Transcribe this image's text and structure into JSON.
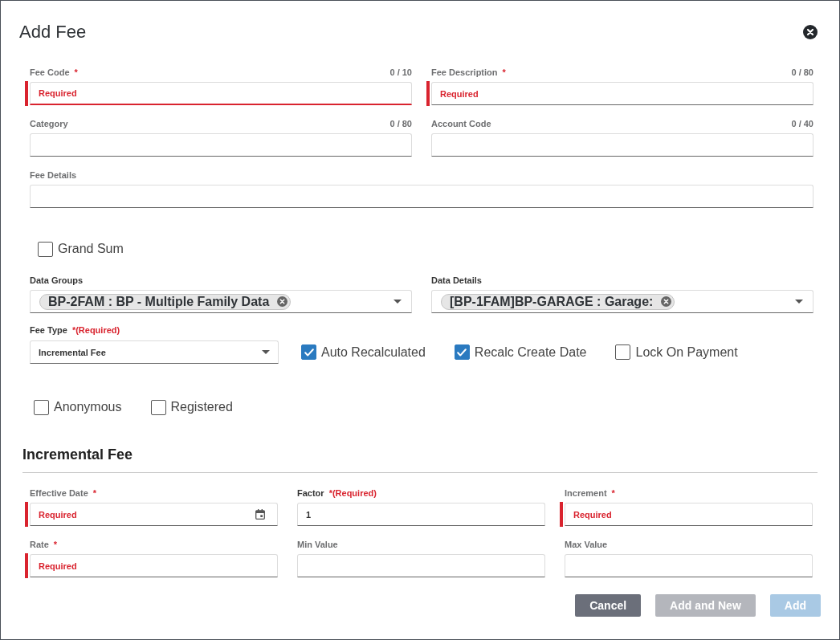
{
  "dialog": {
    "title": "Add Fee"
  },
  "fee_rows": [
    [
      {
        "kind": "text",
        "label": "Fee Code",
        "required_mark": "*",
        "counter": "0 / 10",
        "placeholder": "Required",
        "invalid": true,
        "focused": true
      },
      {
        "kind": "text",
        "label": "Fee Description",
        "required_mark": "*",
        "counter": "0 / 80",
        "placeholder": "Required",
        "invalid": true,
        "focused": false
      }
    ],
    [
      {
        "kind": "text",
        "label": "Category",
        "counter": "0 / 80",
        "invalid": false,
        "focused": false
      },
      {
        "kind": "text",
        "label": "Account Code",
        "counter": "0 / 40",
        "invalid": false,
        "focused": false
      }
    ],
    [
      {
        "kind": "text",
        "label": "Fee Details",
        "invalid": false,
        "focused": false
      }
    ]
  ],
  "grand_sum": {
    "label": "Grand Sum",
    "checked": false
  },
  "data_selects": [
    {
      "label": "Data Groups",
      "chips": [
        "BP-2FAM : BP - Multiple Family Data"
      ]
    },
    {
      "label": "Data Details",
      "chips": [
        "[BP-1FAM]BP-GARAGE : Garage:"
      ]
    }
  ],
  "fee_type": {
    "label": "Fee Type",
    "required_mark": "*(Required)",
    "value": "Incremental Fee"
  },
  "recalc_options": [
    {
      "label": "Auto Recalculated",
      "checked": true
    },
    {
      "label": "Recalc Create Date",
      "checked": true
    },
    {
      "label": "Lock On Payment",
      "checked": false
    }
  ],
  "visibility_options": [
    {
      "label": "Anonymous",
      "checked": false
    },
    {
      "label": "Registered",
      "checked": false
    }
  ],
  "incremental_fee": {
    "title": "Incremental Fee",
    "rows": [
      [
        {
          "kind": "date",
          "label": "Effective Date",
          "required_mark": "*",
          "placeholder": "Required",
          "invalid": true,
          "focused": false
        },
        {
          "kind": "text",
          "label": "Factor",
          "required_mark": "*(Required)",
          "value": "1",
          "invalid": false,
          "focused": false
        },
        {
          "kind": "text",
          "label": "Increment",
          "required_mark": "*",
          "placeholder": "Required",
          "invalid": true,
          "focused": false
        }
      ],
      [
        {
          "kind": "text",
          "label": "Rate",
          "required_mark": "*",
          "placeholder": "Required",
          "invalid": true,
          "focused": false
        },
        {
          "kind": "text",
          "label": "Min Value",
          "invalid": false,
          "focused": false
        },
        {
          "kind": "text",
          "label": "Max Value",
          "invalid": false,
          "focused": false
        }
      ]
    ]
  },
  "buttons": [
    {
      "label": "Cancel",
      "kind": "cancel",
      "disabled": false
    },
    {
      "label": "Add and New",
      "kind": "secondary",
      "disabled": true
    },
    {
      "label": "Add",
      "kind": "primary",
      "disabled": true
    }
  ]
}
